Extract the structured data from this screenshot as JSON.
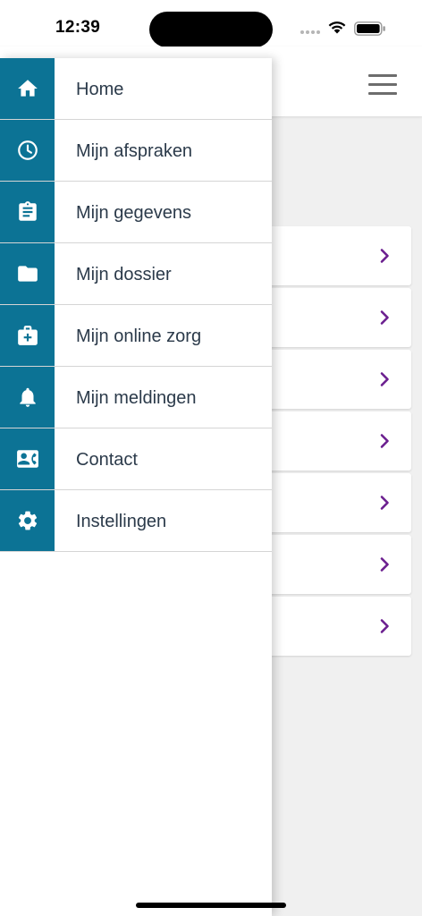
{
  "status_bar": {
    "time": "12:39"
  },
  "colors": {
    "accent": "#0c7395",
    "chevron": "#6b1f8f",
    "label": "#2b3a4a"
  },
  "background_list": {
    "row_count": 7,
    "chevron_icon": "chevron-right-icon"
  },
  "menu": {
    "items": [
      {
        "label": "Home",
        "icon": "home-icon"
      },
      {
        "label": "Mijn afspraken",
        "icon": "clock-icon"
      },
      {
        "label": "Mijn gegevens",
        "icon": "clipboard-icon"
      },
      {
        "label": "Mijn dossier",
        "icon": "folder-icon"
      },
      {
        "label": "Mijn online zorg",
        "icon": "medical-kit-icon"
      },
      {
        "label": "Mijn meldingen",
        "icon": "bell-icon"
      },
      {
        "label": "Contact",
        "icon": "contact-card-icon"
      },
      {
        "label": "Instellingen",
        "icon": "gear-icon"
      }
    ]
  }
}
